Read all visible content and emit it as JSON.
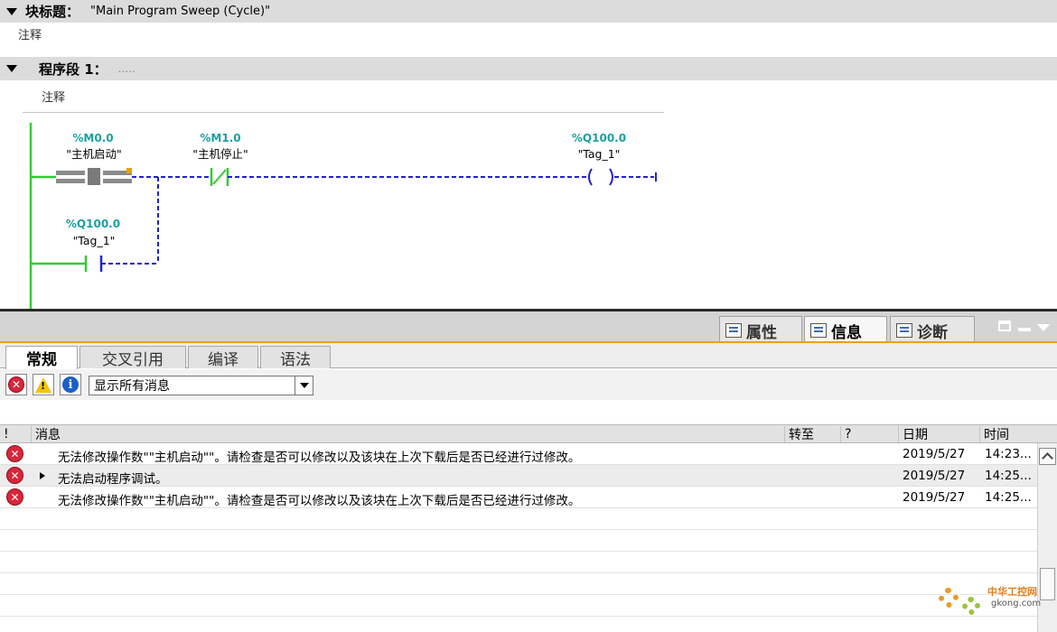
{
  "editor": {
    "block_title_label": "块标题：",
    "block_title_value": "\"Main Program Sweep (Cycle)\"",
    "block_comment": "注释",
    "network_label": "程序段 1：",
    "network_value": ".....",
    "network_comment": "注释",
    "contacts": [
      {
        "address": "%M0.0",
        "name": "\"主机启动\""
      },
      {
        "address": "%M1.0",
        "name": "\"主机停止\""
      },
      {
        "address": "%Q100.0",
        "name": "\"Tag_1\""
      },
      {
        "address": "%Q100.0",
        "name": "\"Tag_1\""
      }
    ]
  },
  "inspector": {
    "tabs": [
      {
        "label": "属性"
      },
      {
        "label": "信息"
      },
      {
        "label": "诊断"
      }
    ],
    "sub_tabs": [
      "常规",
      "交叉引用",
      "编译",
      "语法"
    ],
    "filter": {
      "selected": "显示所有消息"
    },
    "columns": {
      "severity": "!",
      "message": "消息",
      "goto": "转至",
      "help": "?",
      "date": "日期",
      "time": "时间"
    },
    "messages": [
      {
        "text": "无法修改操作数\"\"主机启动\"\"。请检查是否可以修改以及该块在上次下载后是否已经进行过修改。",
        "date": "2019/5/27",
        "time": "14:23..."
      },
      {
        "text": "无法启动程序调试。",
        "date": "2019/5/27",
        "time": "14:25..."
      },
      {
        "text": "无法修改操作数\"\"主机启动\"\"。请检查是否可以修改以及该块在上次下载后是否已经进行过修改。",
        "date": "2019/5/27",
        "time": "14:25..."
      }
    ]
  },
  "watermark": {
    "line1": "中华工控网",
    "line2": "gkong.com"
  },
  "colors": {
    "accent": "#f0a000",
    "error": "#d9263a",
    "power_rail": "#33cc33",
    "wire": "#2222cc",
    "tag": "#1aa0a0"
  }
}
